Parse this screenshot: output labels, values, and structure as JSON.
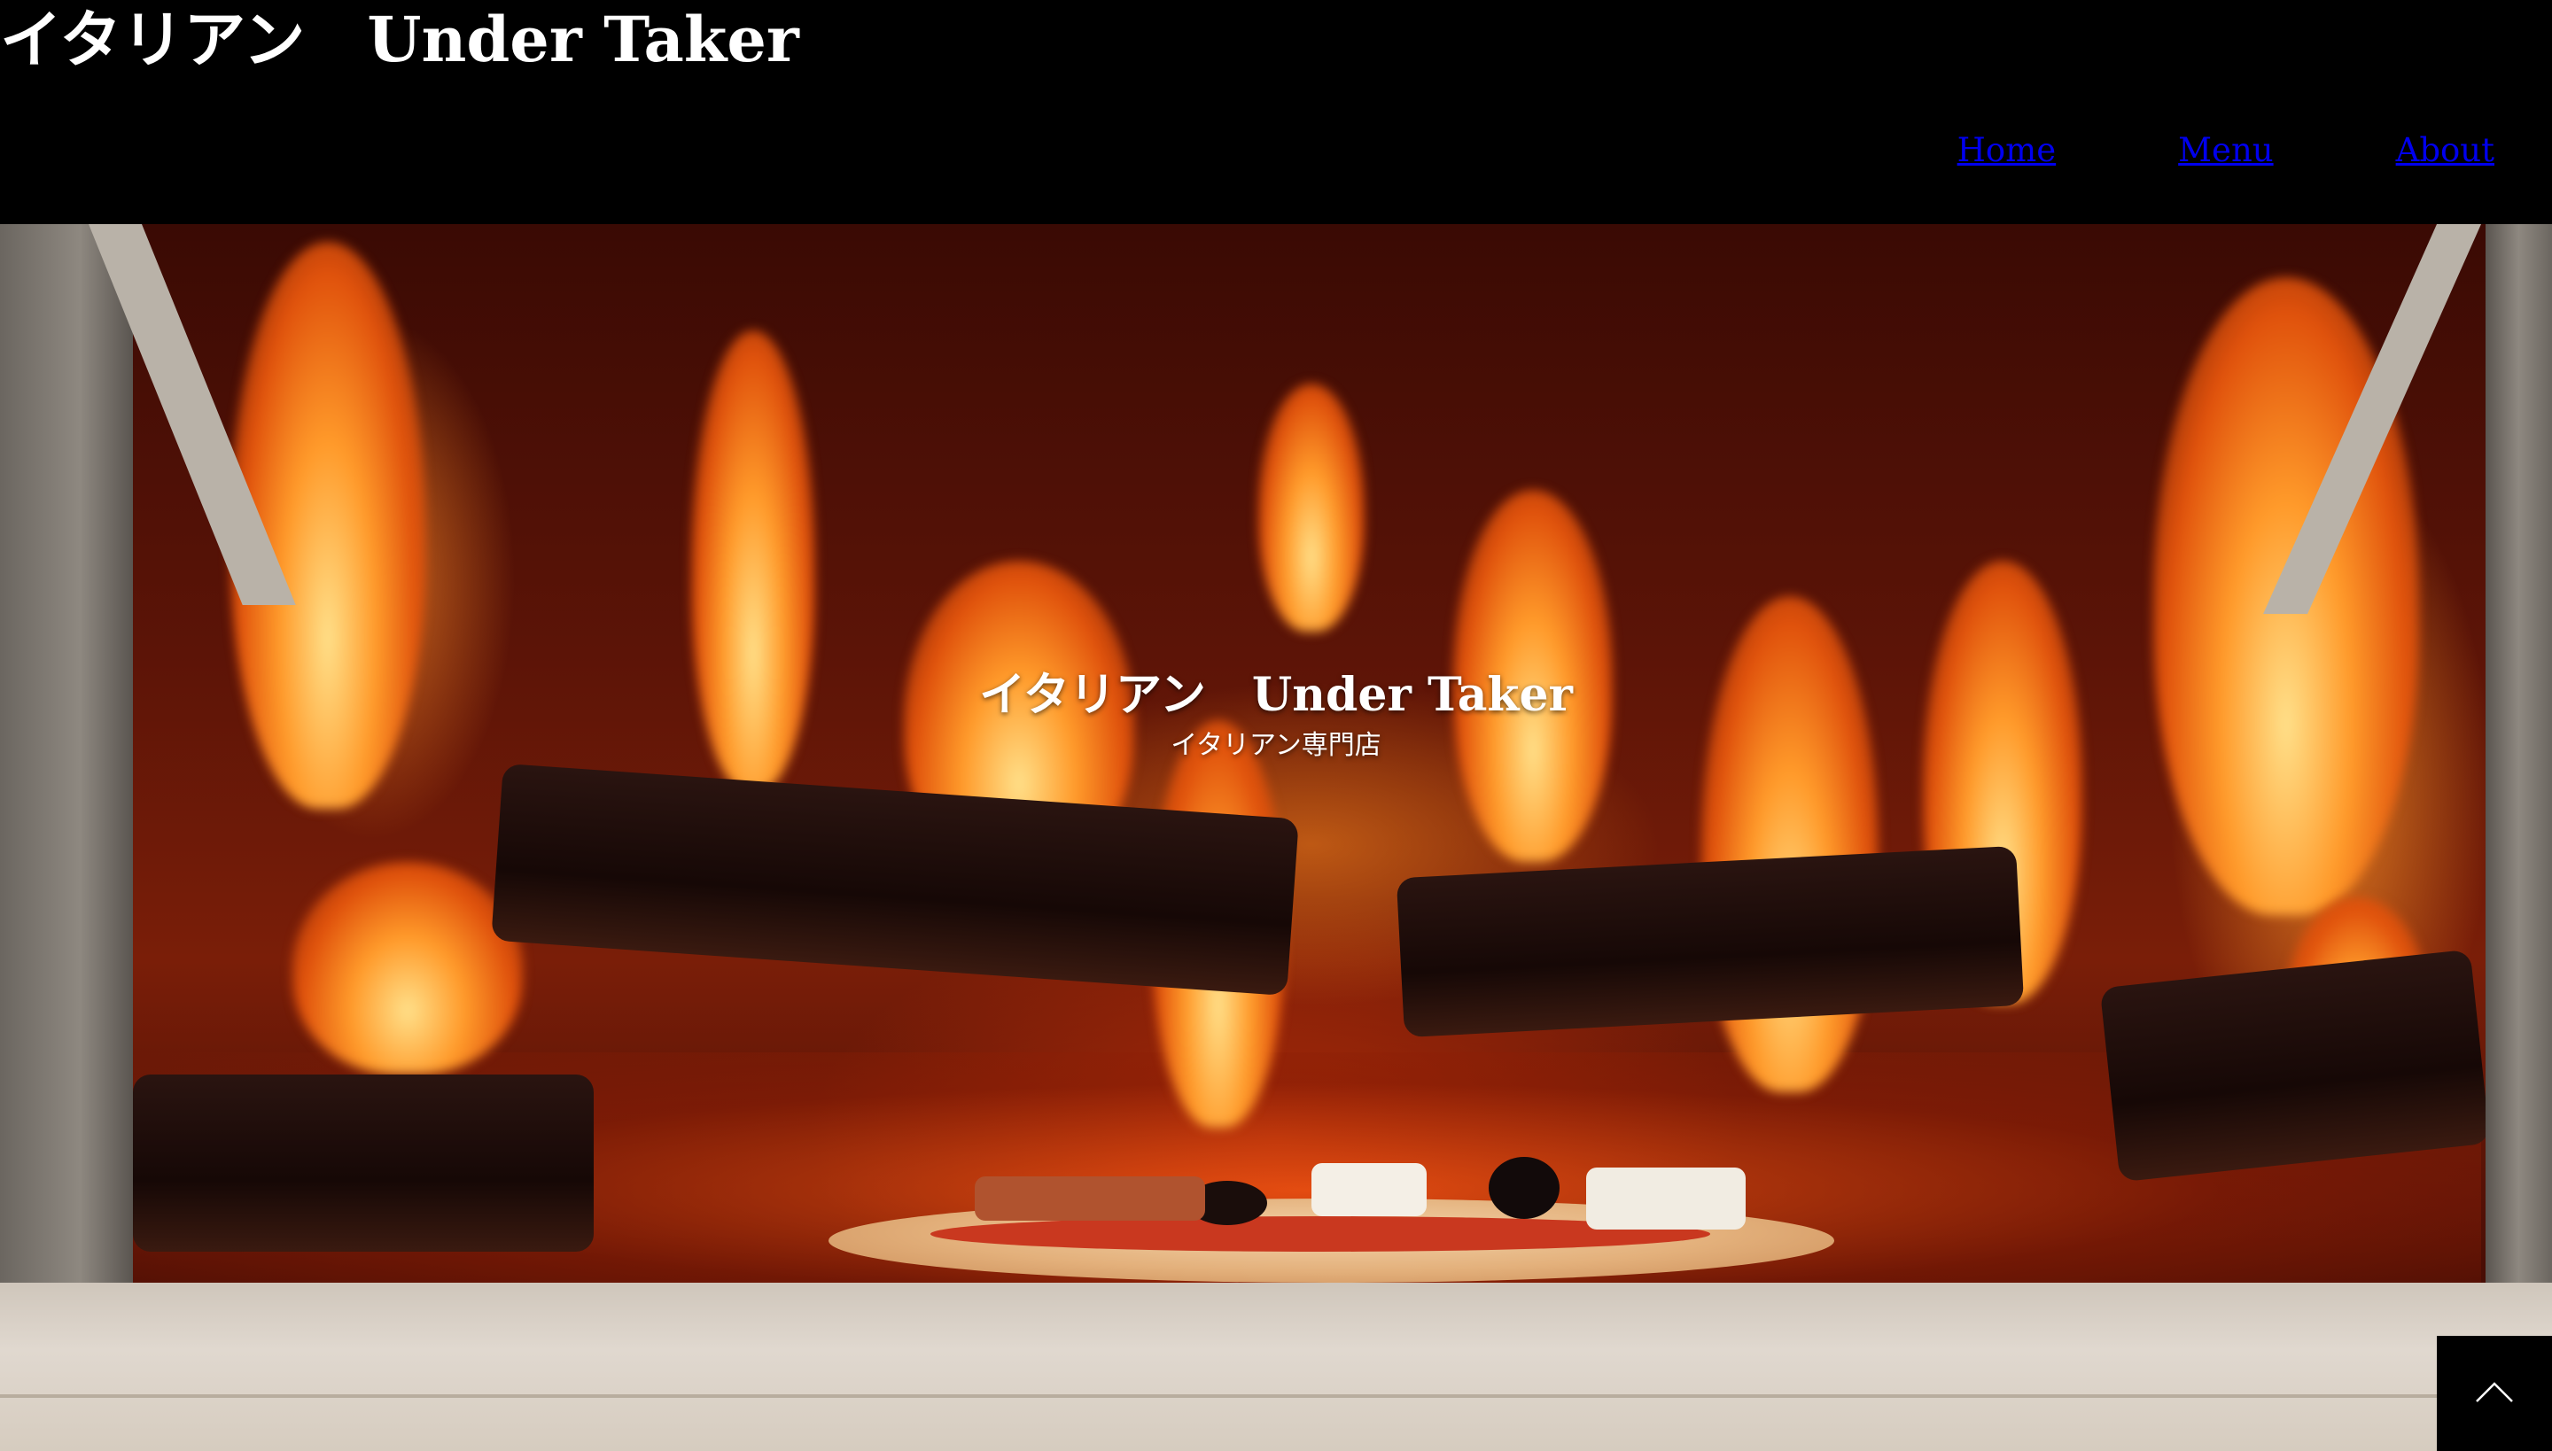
{
  "header": {
    "logo": "イタリアン　Under Taker",
    "nav": [
      {
        "label": "Home"
      },
      {
        "label": "Menu"
      },
      {
        "label": "About"
      }
    ]
  },
  "hero": {
    "title": "イタリアン　Under Taker",
    "subtitle": "イタリアン専門店",
    "background_image": "wood-fired pizza oven with flames and a pizza"
  },
  "back_to_top": {
    "icon": "chevron-up-icon"
  },
  "colors": {
    "header_bg": "#000000",
    "link": "#0000ee",
    "text": "#ffffff"
  }
}
